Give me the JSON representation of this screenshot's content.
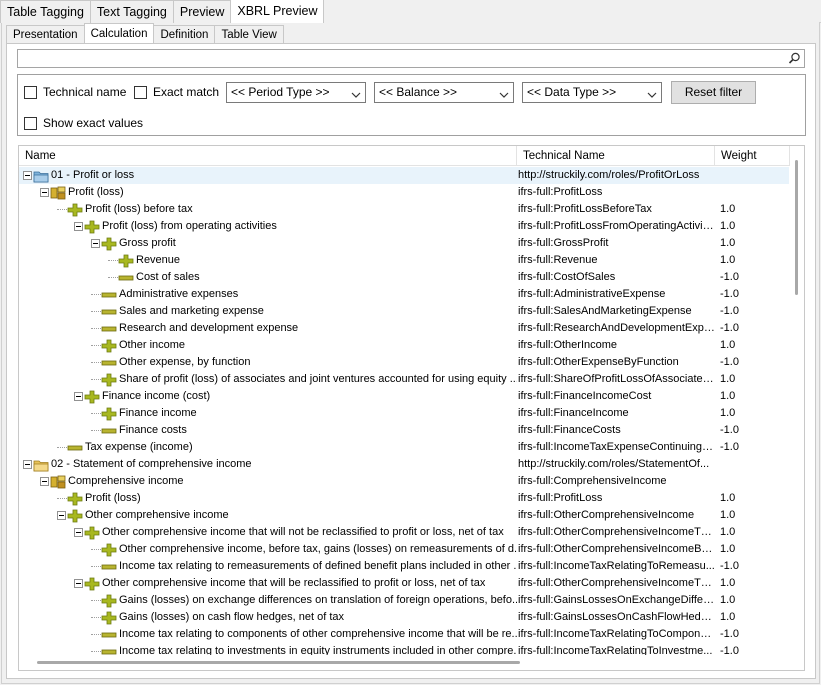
{
  "top_tabs": [
    {
      "label": "Table Tagging",
      "active": false
    },
    {
      "label": "Text Tagging",
      "active": false
    },
    {
      "label": "Preview",
      "active": false
    },
    {
      "label": "XBRL Preview",
      "active": true
    }
  ],
  "sub_tabs": [
    {
      "label": "Presentation",
      "active": false
    },
    {
      "label": "Calculation",
      "active": true
    },
    {
      "label": "Definition",
      "active": false
    },
    {
      "label": "Table View",
      "active": false
    }
  ],
  "search": {
    "value": "",
    "placeholder": ""
  },
  "filter": {
    "technical_name_label": "Technical name",
    "exact_match_label": "Exact match",
    "show_exact_values_label": "Show exact values",
    "period_type": "<< Period Type >>",
    "balance": "<< Balance >>",
    "data_type": "<< Data Type >>",
    "reset_label": "Reset filter"
  },
  "columns": {
    "name": "Name",
    "technical_name": "Technical Name",
    "weight": "Weight"
  },
  "rows": [
    {
      "level": 0,
      "icon": "folder-blue",
      "expanded": true,
      "name": "01 - Profit or loss",
      "tech": "http://struckily.com/roles/ProfitOrLoss",
      "weight": "",
      "selected": true
    },
    {
      "level": 1,
      "icon": "abstract",
      "expanded": true,
      "name": "Profit (loss)",
      "tech": "ifrs-full:ProfitLoss",
      "weight": ""
    },
    {
      "level": 2,
      "icon": "plus",
      "expanded": false,
      "name": "Profit (loss) before tax",
      "tech": "ifrs-full:ProfitLossBeforeTax",
      "weight": "1.0"
    },
    {
      "level": 3,
      "icon": "plus",
      "expanded": true,
      "name": "Profit (loss) from operating activities",
      "tech": "ifrs-full:ProfitLossFromOperatingActivities",
      "weight": "1.0"
    },
    {
      "level": 4,
      "icon": "plus",
      "expanded": true,
      "name": "Gross profit",
      "tech": "ifrs-full:GrossProfit",
      "weight": "1.0"
    },
    {
      "level": 5,
      "icon": "plus",
      "expanded": false,
      "name": "Revenue",
      "tech": "ifrs-full:Revenue",
      "weight": "1.0"
    },
    {
      "level": 5,
      "icon": "minus",
      "expanded": false,
      "name": "Cost of sales",
      "tech": "ifrs-full:CostOfSales",
      "weight": "-1.0"
    },
    {
      "level": 4,
      "icon": "minus",
      "expanded": false,
      "name": "Administrative expenses",
      "tech": "ifrs-full:AdministrativeExpense",
      "weight": "-1.0"
    },
    {
      "level": 4,
      "icon": "minus",
      "expanded": false,
      "name": "Sales and marketing expense",
      "tech": "ifrs-full:SalesAndMarketingExpense",
      "weight": "-1.0"
    },
    {
      "level": 4,
      "icon": "minus",
      "expanded": false,
      "name": "Research and development expense",
      "tech": "ifrs-full:ResearchAndDevelopmentExpe...",
      "weight": "-1.0"
    },
    {
      "level": 4,
      "icon": "plus",
      "expanded": false,
      "name": "Other income",
      "tech": "ifrs-full:OtherIncome",
      "weight": "1.0"
    },
    {
      "level": 4,
      "icon": "minus",
      "expanded": false,
      "name": "Other expense, by function",
      "tech": "ifrs-full:OtherExpenseByFunction",
      "weight": "-1.0"
    },
    {
      "level": 4,
      "icon": "plus",
      "expanded": false,
      "name": "Share of profit (loss) of associates and joint ventures accounted for using equity ...",
      "tech": "ifrs-full:ShareOfProfitLossOfAssociates...",
      "weight": "1.0"
    },
    {
      "level": 3,
      "icon": "plus",
      "expanded": true,
      "name": "Finance income (cost)",
      "tech": "ifrs-full:FinanceIncomeCost",
      "weight": "1.0"
    },
    {
      "level": 4,
      "icon": "plus",
      "expanded": false,
      "name": "Finance income",
      "tech": "ifrs-full:FinanceIncome",
      "weight": "1.0"
    },
    {
      "level": 4,
      "icon": "minus",
      "expanded": false,
      "name": "Finance costs",
      "tech": "ifrs-full:FinanceCosts",
      "weight": "-1.0"
    },
    {
      "level": 2,
      "icon": "minus",
      "expanded": false,
      "name": "Tax expense (income)",
      "tech": "ifrs-full:IncomeTaxExpenseContinuingO...",
      "weight": "-1.0"
    },
    {
      "level": 0,
      "icon": "folder-yellow",
      "expanded": true,
      "name": "02 - Statement of comprehensive income",
      "tech": "http://struckily.com/roles/StatementOf...",
      "weight": ""
    },
    {
      "level": 1,
      "icon": "abstract",
      "expanded": true,
      "name": "Comprehensive income",
      "tech": "ifrs-full:ComprehensiveIncome",
      "weight": ""
    },
    {
      "level": 2,
      "icon": "plus",
      "expanded": false,
      "name": "Profit (loss)",
      "tech": "ifrs-full:ProfitLoss",
      "weight": "1.0"
    },
    {
      "level": 2,
      "icon": "plus",
      "expanded": true,
      "name": "Other comprehensive income",
      "tech": "ifrs-full:OtherComprehensiveIncome",
      "weight": "1.0"
    },
    {
      "level": 3,
      "icon": "plus",
      "expanded": true,
      "name": "Other comprehensive income that will not be reclassified to profit or loss, net of tax",
      "tech": "ifrs-full:OtherComprehensiveIncomeTh...",
      "weight": "1.0"
    },
    {
      "level": 4,
      "icon": "plus",
      "expanded": false,
      "name": "Other comprehensive income, before tax, gains (losses) on remeasurements of d...",
      "tech": "ifrs-full:OtherComprehensiveIncomeBef...",
      "weight": "1.0"
    },
    {
      "level": 4,
      "icon": "minus",
      "expanded": false,
      "name": "Income tax relating to remeasurements of defined benefit plans included in other ...",
      "tech": "ifrs-full:IncomeTaxRelatingToRemeasu...",
      "weight": "-1.0"
    },
    {
      "level": 3,
      "icon": "plus",
      "expanded": true,
      "name": "Other comprehensive income that will be reclassified to profit or loss, net of tax",
      "tech": "ifrs-full:OtherComprehensiveIncomeTh...",
      "weight": "1.0"
    },
    {
      "level": 4,
      "icon": "plus",
      "expanded": false,
      "name": "Gains (losses) on exchange differences on translation of foreign operations, befo...",
      "tech": "ifrs-full:GainsLossesOnExchangeDiffer...",
      "weight": "1.0"
    },
    {
      "level": 4,
      "icon": "plus",
      "expanded": false,
      "name": "Gains (losses) on cash flow hedges, net of tax",
      "tech": "ifrs-full:GainsLossesOnCashFlowHedge...",
      "weight": "1.0"
    },
    {
      "level": 4,
      "icon": "minus",
      "expanded": false,
      "name": "Income tax relating to components of other comprehensive income that will be re...",
      "tech": "ifrs-full:IncomeTaxRelatingToCompone...",
      "weight": "-1.0"
    },
    {
      "level": 4,
      "icon": "minus",
      "expanded": false,
      "name": "Income tax relating to investments in equity instruments included in other compre...",
      "tech": "ifrs-full:IncomeTaxRelatingToInvestme...",
      "weight": "-1.0"
    }
  ],
  "colors": {
    "plus_icon": "#a8b820",
    "minus_icon": "#b8b430",
    "selection": "#e8f3fb"
  }
}
